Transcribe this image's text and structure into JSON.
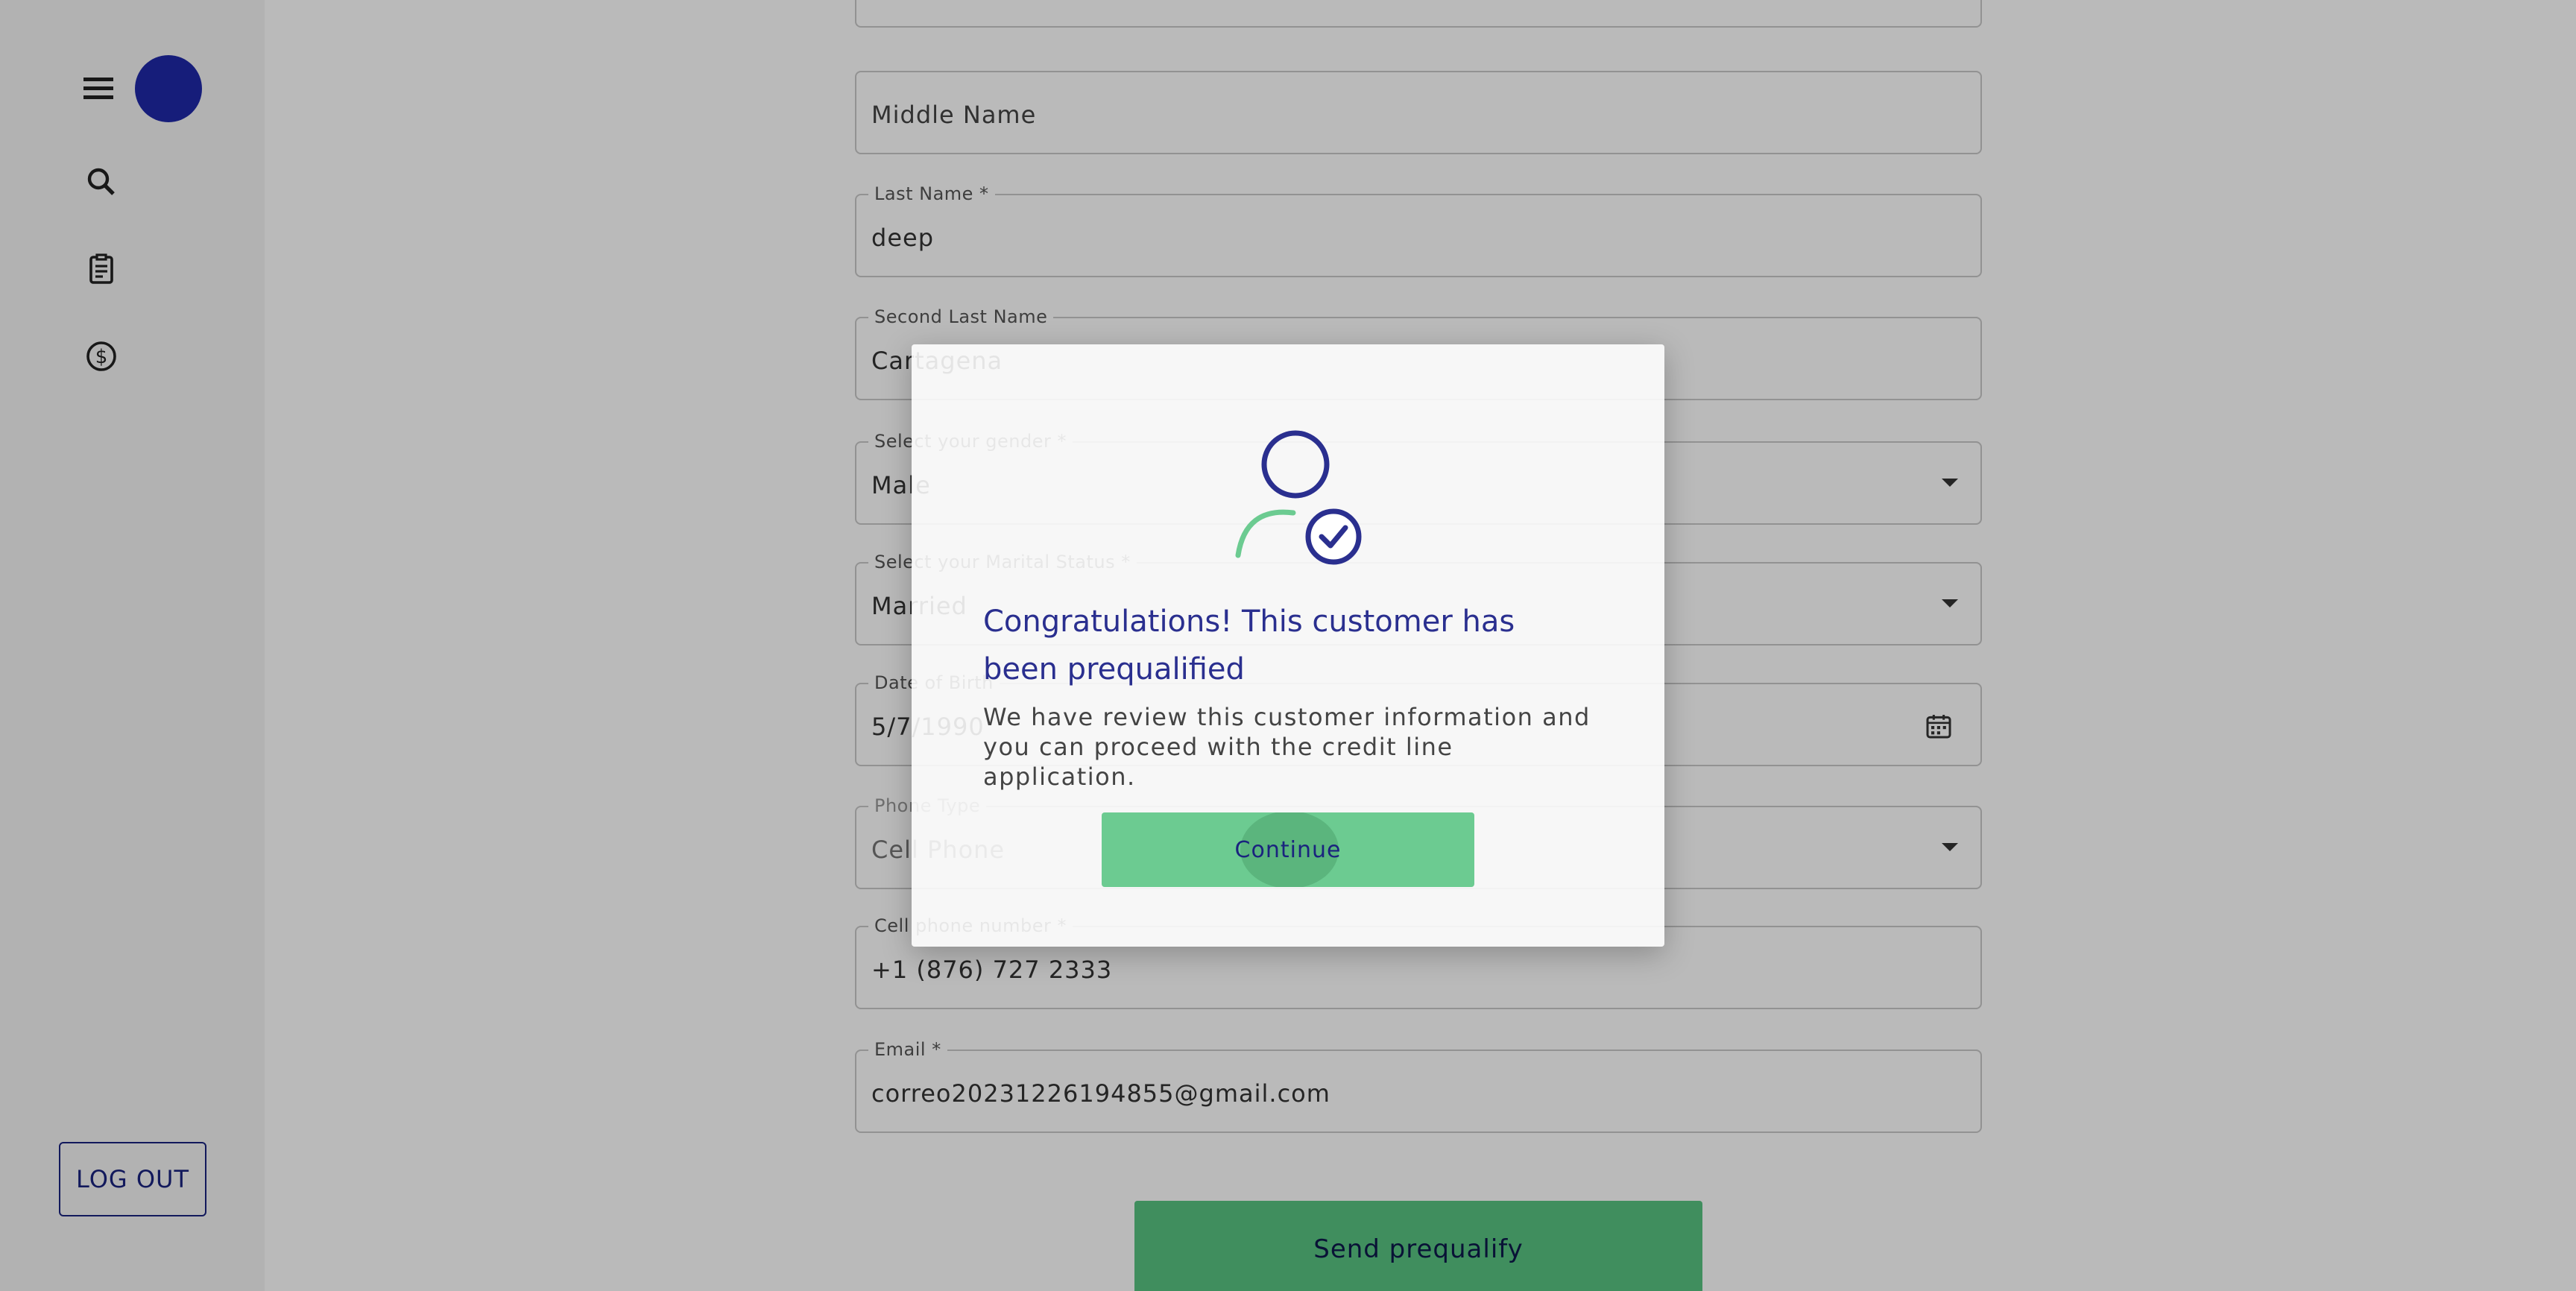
{
  "sidebar": {
    "icons": [
      "menu-icon",
      "search-icon",
      "clipboard-icon",
      "dollar-icon"
    ],
    "logout_label": "LOG OUT"
  },
  "form": {
    "middle_name": {
      "placeholder": "Middle Name"
    },
    "last_name": {
      "label": "Last Name *",
      "value": "deep"
    },
    "second_last_name": {
      "label": "Second Last Name",
      "value": "Cartagena"
    },
    "gender": {
      "label": "Select your gender *",
      "value": "Male"
    },
    "marital_status": {
      "label": "Select your Marital Status *",
      "value": "Married"
    },
    "date_of_birth": {
      "label": "Date of Birth",
      "value": "5/7/1990"
    },
    "phone_type": {
      "label": "Phone Type",
      "value": "Cell Phone"
    },
    "cell_phone": {
      "label": "Cell phone number *",
      "value": "+1 (876) 727 2333"
    },
    "email": {
      "label": "Email *",
      "value": "correo20231226194855@gmail.com"
    },
    "submit_label": "Send prequalify"
  },
  "dialog": {
    "title": "Congratulations! This customer has been prequalified",
    "message": "We have review this customer information and you can proceed with the credit line application.",
    "continue_label": "Continue",
    "icon": "user-check-icon"
  },
  "colors": {
    "accent_navy": "#1a237e",
    "avatar_blue": "#1f29a8",
    "green": "#58c382"
  }
}
